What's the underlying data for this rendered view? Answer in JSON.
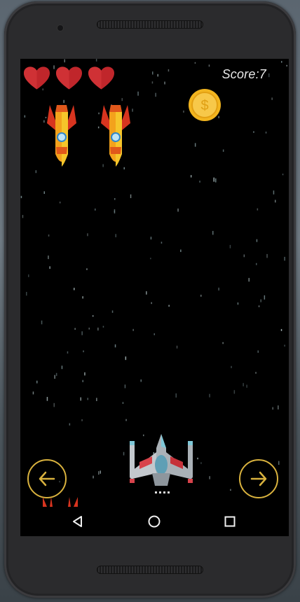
{
  "hud": {
    "lives": 3,
    "score_text": "Score:7"
  },
  "colors": {
    "heart": "#c0262b",
    "coin": "#f2b51f",
    "missile_body": "#f3a21c",
    "button_ring": "#d9b23e",
    "score_text": "#e8e8e8",
    "background": "#000000"
  },
  "entities": {
    "enemies": [
      "missile",
      "missile"
    ],
    "pickup": "gold-coin",
    "player": "spaceship"
  },
  "controls": {
    "left_icon": "arrow-left-icon",
    "right_icon": "arrow-right-icon"
  },
  "navigation": {
    "back_icon": "back-triangle-icon",
    "home_icon": "home-circle-icon",
    "recents_icon": "recents-square-icon"
  }
}
